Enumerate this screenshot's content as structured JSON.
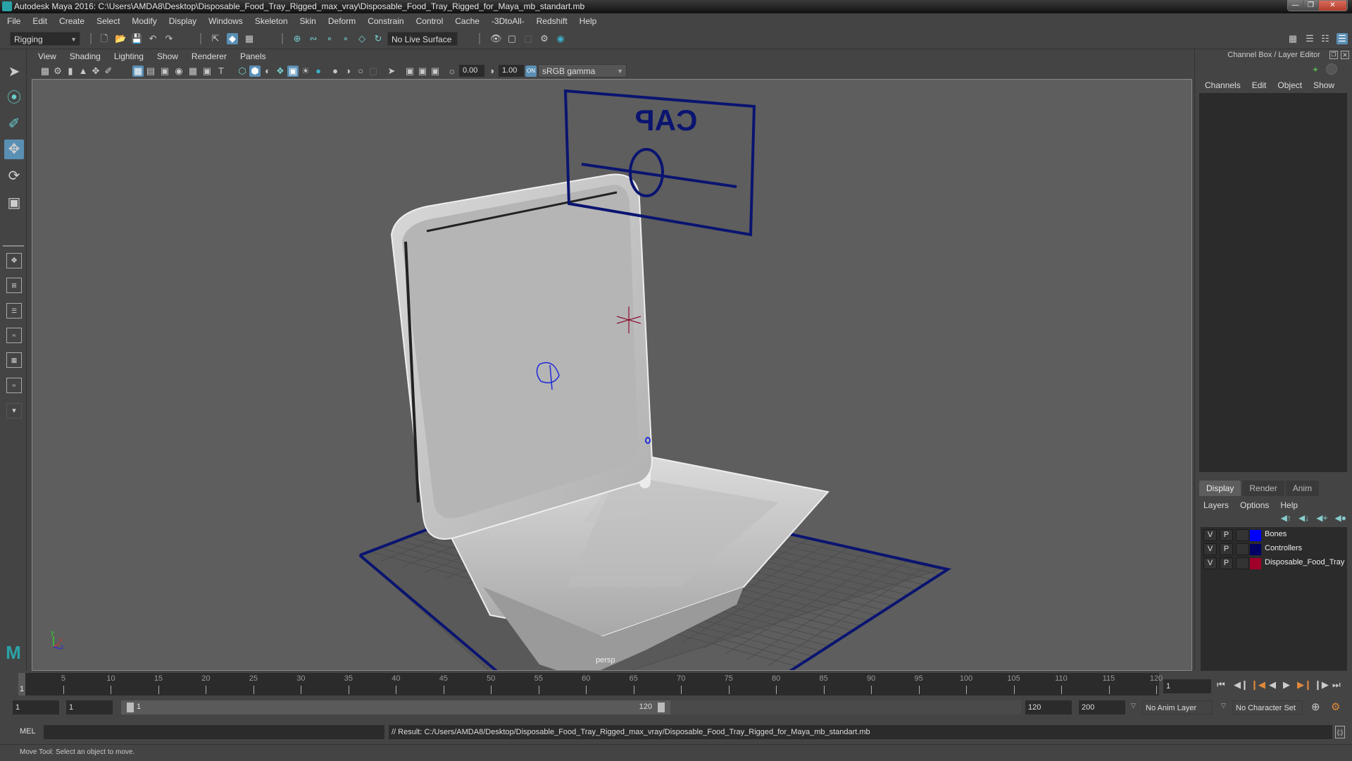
{
  "window": {
    "title": "Autodesk Maya 2016: C:\\Users\\AMDA8\\Desktop\\Disposable_Food_Tray_Rigged_max_vray\\Disposable_Food_Tray_Rigged_for_Maya_mb_standart.mb",
    "controls": [
      "minimize",
      "restore",
      "close"
    ]
  },
  "menubar": [
    "File",
    "Edit",
    "Create",
    "Select",
    "Modify",
    "Display",
    "Windows",
    "Skeleton",
    "Skin",
    "Deform",
    "Constrain",
    "Control",
    "Cache",
    "-3DtoAll-",
    "Redshift",
    "Help"
  ],
  "shelf": {
    "mode": "Rigging",
    "live_surface": "No Live Surface"
  },
  "left_tools": [
    "select-tool",
    "lasso-tool",
    "paint-select-tool",
    "move-tool",
    "rotate-tool",
    "scale-tool"
  ],
  "active_tool": "move-tool",
  "viewport": {
    "menu": [
      "View",
      "Shading",
      "Lighting",
      "Show",
      "Renderer",
      "Panels"
    ],
    "exposure": "0.00",
    "gamma": "1.00",
    "color_space": "sRGB gamma",
    "camera_label": "persp",
    "controller_label": "CAP",
    "axis": {
      "y": "y",
      "x": "x",
      "z": "z"
    },
    "colors": {
      "controller": "#0a1470",
      "bone": "#1f2bd6",
      "locator": "#8b1030",
      "background": "#5e5e5e"
    }
  },
  "channel_box": {
    "title": "Channel Box / Layer Editor",
    "menu": [
      "Channels",
      "Edit",
      "Object",
      "Show"
    ]
  },
  "layer_editor": {
    "tabs": [
      "Display",
      "Render",
      "Anim"
    ],
    "active_tab": "Display",
    "menu": [
      "Layers",
      "Options",
      "Help"
    ],
    "layers": [
      {
        "v": "V",
        "p": "P",
        "color": "#0000ff",
        "name": "Bones"
      },
      {
        "v": "V",
        "p": "P",
        "color": "#000066",
        "name": "Controllers"
      },
      {
        "v": "V",
        "p": "P",
        "color": "#a0002a",
        "name": "Disposable_Food_Tray"
      }
    ]
  },
  "timeline": {
    "ticks": [
      "5",
      "10",
      "15",
      "20",
      "25",
      "30",
      "35",
      "40",
      "45",
      "50",
      "55",
      "60",
      "65",
      "70",
      "75",
      "80",
      "85",
      "90",
      "95",
      "100",
      "105",
      "110",
      "115",
      "120"
    ],
    "current_frame_marker": "1",
    "current_frame": "1",
    "start_max": 1,
    "end_max": 120
  },
  "range": {
    "start": "1",
    "playback_start": "1",
    "slider_start": "1",
    "slider_end": "120",
    "playback_end": "120",
    "end": "200",
    "anim_layer": "No Anim Layer",
    "character_set": "No Character Set"
  },
  "command": {
    "lang": "MEL",
    "input": "",
    "result": "// Result: C:/Users/AMDA8/Desktop/Disposable_Food_Tray_Rigged_max_vray/Disposable_Food_Tray_Rigged_for_Maya_mb_standart.mb"
  },
  "help_line": "Move Tool: Select an object to move."
}
